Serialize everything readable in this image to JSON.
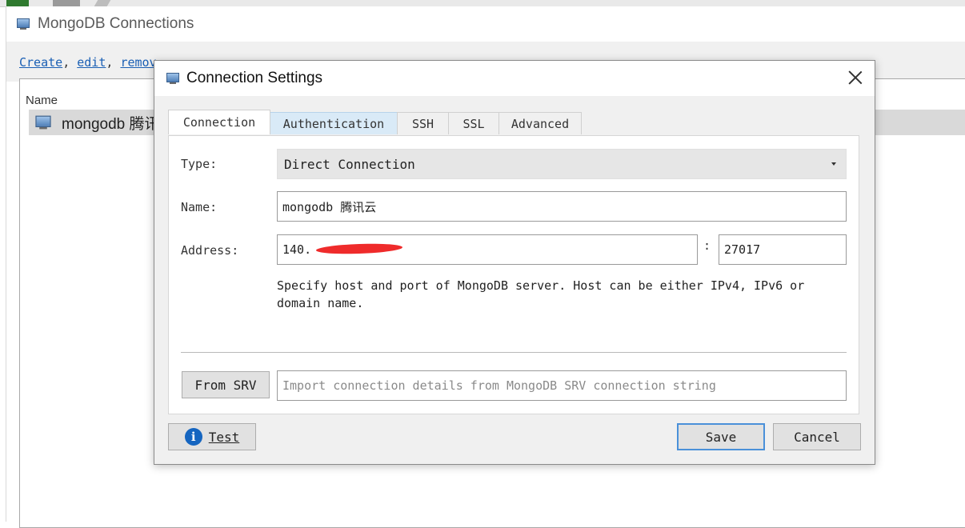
{
  "background_window": {
    "title": "MongoDB Connections",
    "links": {
      "create": "Create",
      "edit": "edit",
      "remove_partial": "remov",
      "sep": ", "
    },
    "list": {
      "column_name": "Name",
      "row_name": "mongodb 腾讯"
    }
  },
  "dialog": {
    "title": "Connection Settings",
    "tabs": [
      "Connection",
      "Authentication",
      "SSH",
      "SSL",
      "Advanced"
    ],
    "fields": {
      "type_label": "Type:",
      "type_value": "Direct Connection",
      "name_label": "Name:",
      "name_value": "mongodb 腾讯云",
      "address_label": "Address:",
      "address_host": "140.",
      "address_separator": ":",
      "address_port": "27017"
    },
    "hint": "Specify host and port of MongoDB server. Host can be either IPv4, IPv6 or domain name.",
    "srv": {
      "button": "From SRV",
      "placeholder": "Import connection details from MongoDB SRV connection string"
    },
    "buttons": {
      "test": "Test",
      "save": "Save",
      "cancel": "Cancel"
    }
  },
  "icons": {
    "window_icon": "monitor-icon",
    "info_icon": "info-icon",
    "close_icon": "close-icon"
  },
  "colors": {
    "tab_hover": "#d9eaf7",
    "link": "#1a5fb4",
    "save_focus": "#4a90d9",
    "redaction": "#ee2020"
  }
}
